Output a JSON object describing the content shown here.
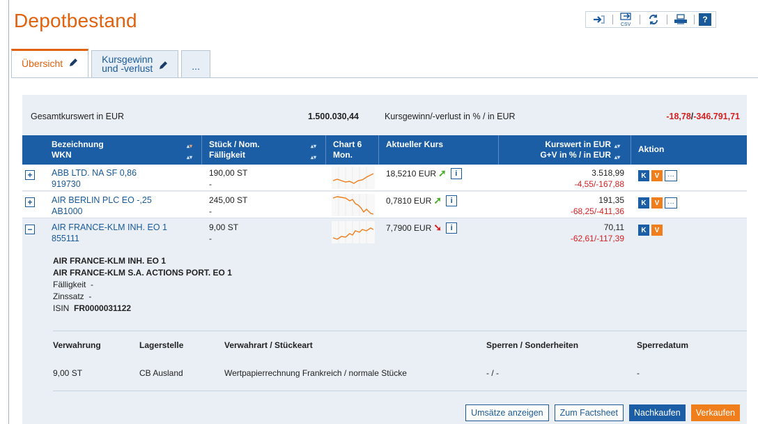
{
  "page": {
    "title": "Depotbestand"
  },
  "toolbar": {
    "export_icon": "login-arrow-icon",
    "csv_icon": "csv-export-icon",
    "refresh_icon": "refresh-icon",
    "print_icon": "print-icon",
    "help_label": "?"
  },
  "tabs": [
    {
      "label": "Übersicht",
      "active": true
    },
    {
      "label": "Kursgewinn\nund -verlust",
      "active": false
    },
    {
      "label": "...",
      "active": false
    }
  ],
  "summary": {
    "total_label": "Gesamtkurswert in EUR",
    "total_value": "1.500.030,44",
    "gain_label": "Kursgewinn/-verlust in % / in EUR",
    "gain_pct": "-18,78",
    "gain_sep": "/",
    "gain_eur": "-346.791,71"
  },
  "columns": {
    "name1": "Bezeichnung",
    "name2": "WKN",
    "qty1": "Stück / Nom.",
    "qty2": "Fälligkeit",
    "chart1": "Chart 6",
    "chart2": "Mon.",
    "kurs": "Aktueller Kurs",
    "kw1": "Kurswert in EUR",
    "kw2": "G+V in % / in EUR",
    "action": "Aktion"
  },
  "rows": [
    {
      "expand": "+",
      "name": "ABB LTD. NA SF 0,86",
      "wkn": "919730",
      "qty": "190,00 ST",
      "due": "-",
      "kurs": "18,5210 EUR",
      "trend": "up",
      "kurswert": "3.518,99",
      "gv": "-4,55/-167,88",
      "has_more": true
    },
    {
      "expand": "+",
      "name": "AIR BERLIN PLC EO -,25",
      "wkn": "AB1000",
      "qty": "245,00 ST",
      "due": "-",
      "kurs": "0,7810 EUR",
      "trend": "up",
      "kurswert": "191,35",
      "gv": "-68,25/-411,36",
      "has_more": true
    },
    {
      "expand": "−",
      "name": "AIR FRANCE-KLM INH. EO 1",
      "wkn": "855111",
      "qty": "9,00 ST",
      "due": "-",
      "kurs": "7,7900 EUR",
      "trend": "down",
      "kurswert": "70,11",
      "gv": "-62,61/-117,39",
      "has_more": false
    }
  ],
  "actions": {
    "buy_short": "K",
    "sell_short": "V",
    "more": "···"
  },
  "detail": {
    "name1": "AIR FRANCE-KLM INH. EO 1",
    "name2": "AIR FRANCE-KLM S.A. ACTIONS PORT. EO 1",
    "faelligkeit_label": "Fälligkeit",
    "faelligkeit_value": "-",
    "zinssatz_label": "Zinssatz",
    "zinssatz_value": "-",
    "isin_label": "ISIN",
    "isin_value": "FR0000031122",
    "headers": [
      "Verwahrung",
      "Lagerstelle",
      "Verwahrart / Stückeart",
      "Sperren / Sonderheiten",
      "Sperredatum"
    ],
    "values": [
      "9,00 ST",
      "CB Ausland",
      "Wertpapierrechnung Frankreich / normale Stücke",
      "- / -",
      "-"
    ]
  },
  "buttons": {
    "umsaetze": "Umsätze anzeigen",
    "factsheet": "Zum Factsheet",
    "nachkaufen": "Nachkaufen",
    "verkaufen": "Verkaufen"
  },
  "colors": {
    "accent": "#e0620e",
    "header_blue": "#1b5ea6",
    "link_blue": "#1a5a9a",
    "negative": "#d42020",
    "positive": "#4cae2a",
    "sell": "#f07e1c"
  }
}
